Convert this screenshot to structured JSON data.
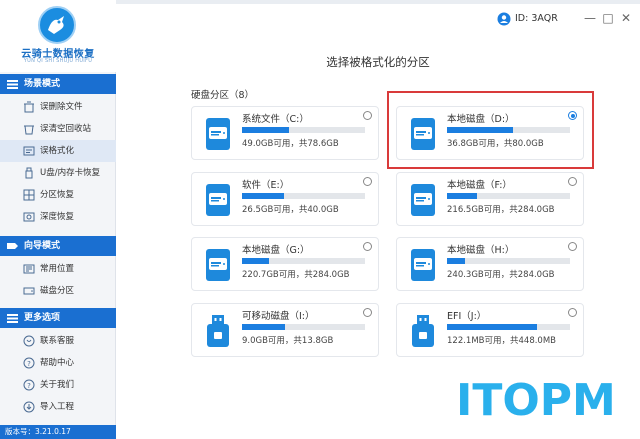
{
  "app": {
    "logo_title": "云骑士数据恢复",
    "logo_subtitle": "YUN QI SHI SHUJU HUIFU",
    "user_id": "ID: 3AQR",
    "version": "版本号：3.21.0.17",
    "window_controls": [
      "—",
      "□",
      "✕"
    ],
    "brand_color": "#1a6fd1"
  },
  "sidebar": {
    "sections": [
      {
        "label": "场景模式",
        "items": [
          {
            "label": "误删除文件",
            "icon": "recycle-icon",
            "active": false
          },
          {
            "label": "误清空回收站",
            "icon": "trash-icon",
            "active": false
          },
          {
            "label": "误格式化",
            "icon": "format-icon",
            "active": true
          },
          {
            "label": "U盘/内存卡恢复",
            "icon": "usb-icon",
            "active": false
          },
          {
            "label": "分区恢复",
            "icon": "partition-icon",
            "active": false
          },
          {
            "label": "深度恢复",
            "icon": "deep-scan-icon",
            "active": false
          }
        ]
      },
      {
        "label": "向导模式",
        "items": [
          {
            "label": "常用位置",
            "icon": "location-icon",
            "active": false
          },
          {
            "label": "磁盘分区",
            "icon": "disk-icon",
            "active": false
          }
        ]
      },
      {
        "label": "更多选项",
        "items": [
          {
            "label": "联系客服",
            "icon": "support-icon",
            "active": false
          },
          {
            "label": "帮助中心",
            "icon": "help-icon",
            "active": false
          },
          {
            "label": "关于我们",
            "icon": "info-icon",
            "active": false
          },
          {
            "label": "导入工程",
            "icon": "import-icon",
            "active": false
          }
        ]
      }
    ]
  },
  "main": {
    "title": "选择被格式化的分区",
    "group_label": "硬盘分区（8）",
    "drives": [
      {
        "name": "系统文件（C:）",
        "size_text": "49.0GB可用，共78.6GB",
        "used_fraction": 0.38,
        "type": "disk",
        "selected": false
      },
      {
        "name": "本地磁盘（D:）",
        "size_text": "36.8GB可用，共80.0GB",
        "used_fraction": 0.54,
        "type": "disk",
        "selected": true
      },
      {
        "name": "软件（E:）",
        "size_text": "26.5GB可用，共40.0GB",
        "used_fraction": 0.34,
        "type": "disk",
        "selected": false
      },
      {
        "name": "本地磁盘（F:）",
        "size_text": "216.5GB可用，共284.0GB",
        "used_fraction": 0.24,
        "type": "disk",
        "selected": false
      },
      {
        "name": "本地磁盘（G:）",
        "size_text": "220.7GB可用，共284.0GB",
        "used_fraction": 0.22,
        "type": "disk",
        "selected": false
      },
      {
        "name": "本地磁盘（H:）",
        "size_text": "240.3GB可用，共284.0GB",
        "used_fraction": 0.15,
        "type": "disk",
        "selected": false
      },
      {
        "name": "可移动磁盘（I:）",
        "size_text": "9.0GB可用，共13.8GB",
        "used_fraction": 0.35,
        "type": "usb",
        "selected": false
      },
      {
        "name": "EFI（J:）",
        "size_text": "122.1MB可用，共448.0MB",
        "used_fraction": 0.73,
        "type": "usb",
        "selected": false
      }
    ]
  },
  "watermark": {
    "text": "ITOPM"
  }
}
